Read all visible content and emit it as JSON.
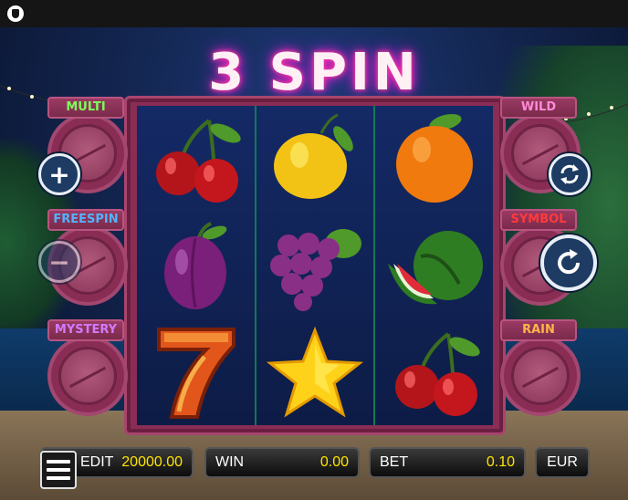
{
  "top_bar": {
    "icon": "shield-icon"
  },
  "game": {
    "title": "3 SPIN",
    "reels": [
      [
        "cherries",
        "plum",
        "seven"
      ],
      [
        "lemon",
        "grapes",
        "star"
      ],
      [
        "orange",
        "watermelon",
        "cherries"
      ]
    ]
  },
  "left_features": [
    {
      "label": "MULTI",
      "color": "#7dff5a"
    },
    {
      "label": "FREESPIN",
      "color": "#4fb4ff"
    },
    {
      "label": "MYSTERY",
      "color": "#d07bff"
    }
  ],
  "right_features": [
    {
      "label": "WILD",
      "color": "#ff8ad8"
    },
    {
      "label": "SYMBOL",
      "color": "#ff3a3a"
    },
    {
      "label": "RAIN",
      "color": "#ffb347"
    }
  ],
  "controls": {
    "increase_symbol": "+",
    "decrease_symbol": "−",
    "autoplay_icon": "autoplay-icon",
    "spin_icon": "spin-icon"
  },
  "bottom_bar": {
    "credit_label": "EDIT",
    "credit_value": "20000.00",
    "win_label": "WIN",
    "win_value": "0.00",
    "bet_label": "BET",
    "bet_value": "0.10",
    "currency": "EUR"
  },
  "colors": {
    "value_yellow": "#ffe400",
    "neon_pink": "#ff2a9a",
    "frame": "#8a2d54"
  }
}
